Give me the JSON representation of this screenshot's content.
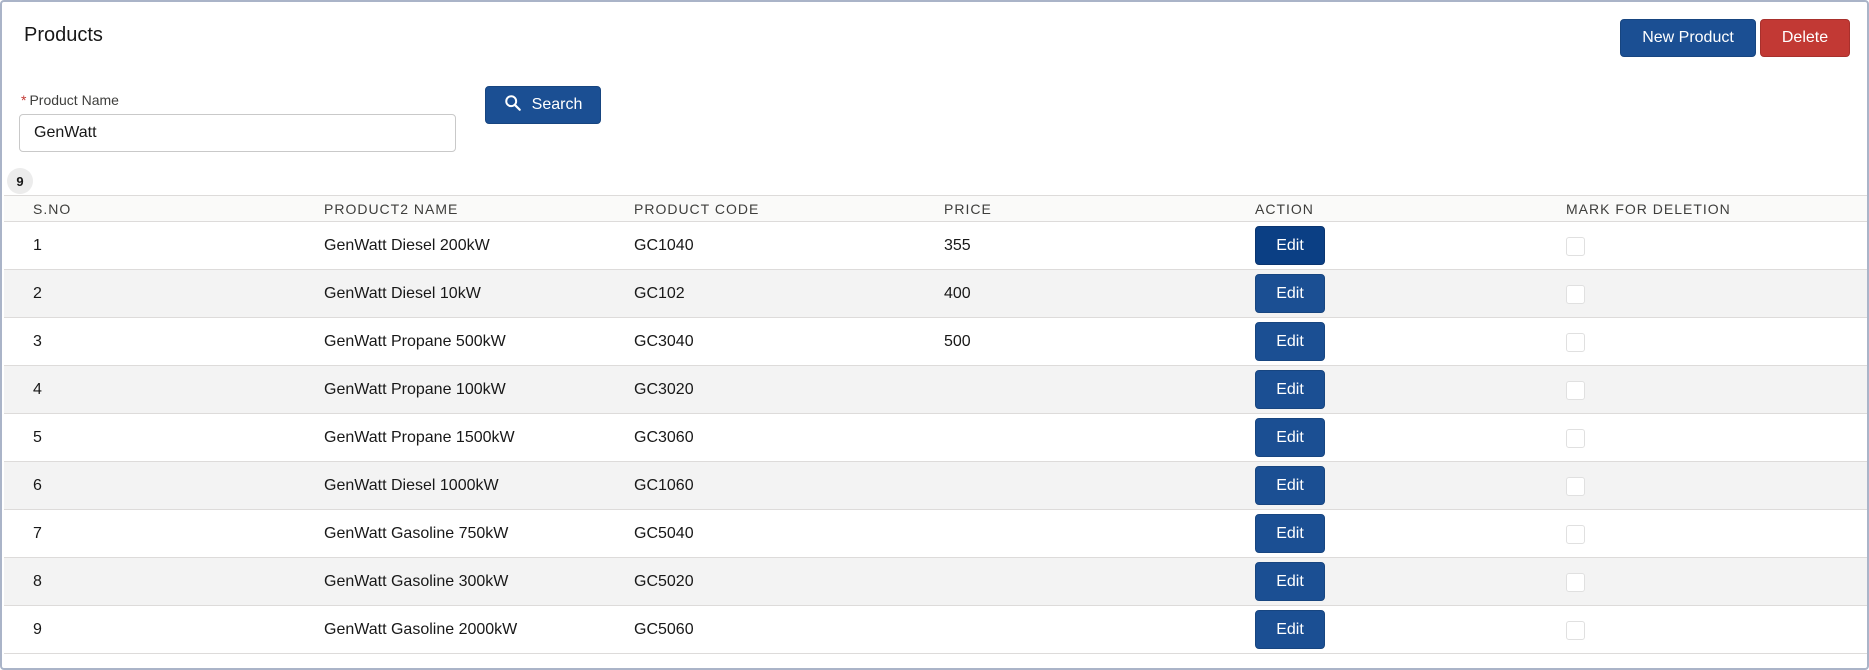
{
  "card": {
    "title": "Products",
    "new_button": "New Product",
    "delete_button": "Delete"
  },
  "search": {
    "required_marker": "*",
    "label": "Product Name",
    "value": "GenWatt",
    "button": "Search"
  },
  "count": "9",
  "table": {
    "headers": [
      "S.NO",
      "PRODUCT2 NAME",
      "PRODUCT CODE",
      "PRICE",
      "ACTION",
      "MARK FOR DELETION"
    ],
    "edit_label": "Edit",
    "rows": [
      {
        "sno": "1",
        "name": "GenWatt Diesel 200kW",
        "code": "GC1040",
        "price": "355"
      },
      {
        "sno": "2",
        "name": "GenWatt Diesel 10kW",
        "code": "GC102",
        "price": "400"
      },
      {
        "sno": "3",
        "name": "GenWatt Propane 500kW",
        "code": "GC3040",
        "price": "500"
      },
      {
        "sno": "4",
        "name": "GenWatt Propane 100kW",
        "code": "GC3020",
        "price": ""
      },
      {
        "sno": "5",
        "name": "GenWatt Propane 1500kW",
        "code": "GC3060",
        "price": ""
      },
      {
        "sno": "6",
        "name": "GenWatt Diesel 1000kW",
        "code": "GC1060",
        "price": ""
      },
      {
        "sno": "7",
        "name": "GenWatt Gasoline 750kW",
        "code": "GC5040",
        "price": ""
      },
      {
        "sno": "8",
        "name": "GenWatt Gasoline 300kW",
        "code": "GC5020",
        "price": ""
      },
      {
        "sno": "9",
        "name": "GenWatt Gasoline 2000kW",
        "code": "GC5060",
        "price": ""
      }
    ]
  },
  "icons": {
    "search": "search-icon",
    "checkbox": "checkbox-icon"
  },
  "colors": {
    "brand": "#1b4f93",
    "destructive": "#c23934"
  }
}
